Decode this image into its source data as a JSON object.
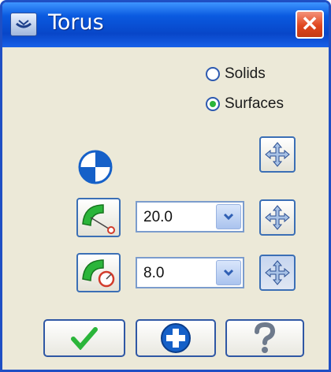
{
  "window": {
    "title": "Torus"
  },
  "icons": {
    "title": "torus-app-icon",
    "close": "close-icon",
    "center": "center-point-icon",
    "major": "major-radius-icon",
    "minor": "minor-radius-icon",
    "move": "move-icon",
    "ok": "checkmark-icon",
    "apply": "plus-icon",
    "help": "question-mark-icon"
  },
  "close_glyph": "✕",
  "options": {
    "solids_label": "Solids",
    "surfaces_label": "Surfaces",
    "selected": "Surfaces"
  },
  "major_radius": {
    "value": "20.0"
  },
  "minor_radius": {
    "value": "8.0"
  },
  "colors": {
    "titlebar": "#0a5ae0",
    "accent_green": "#2bb53a",
    "accent_blue": "#1560c8"
  }
}
